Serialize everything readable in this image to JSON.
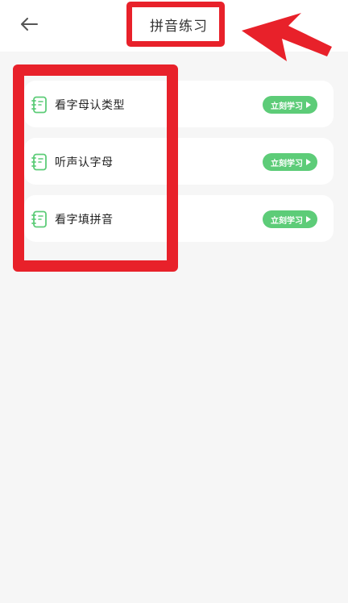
{
  "header": {
    "title": "拼音练习",
    "back_icon": "arrow-left-icon"
  },
  "items": [
    {
      "label": "看字母认类型",
      "icon": "notebook-icon",
      "button_label": "立刻学习"
    },
    {
      "label": "听声认字母",
      "icon": "notebook-icon",
      "button_label": "立刻学习"
    },
    {
      "label": "看字填拼音",
      "icon": "notebook-icon",
      "button_label": "立刻学习"
    }
  ],
  "colors": {
    "accent_green": "#5dcc78",
    "annotation_red": "#e8212a",
    "background": "#f6f6f6"
  }
}
